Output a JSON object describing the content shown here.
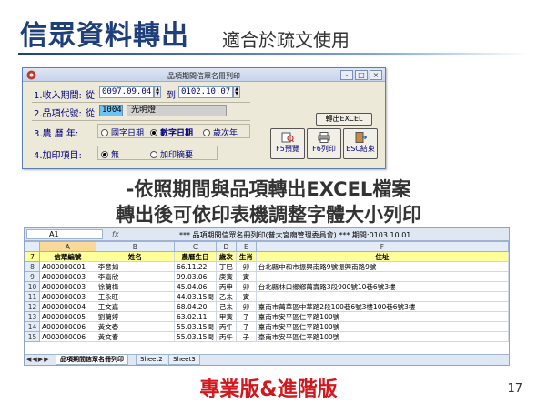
{
  "slide": {
    "title": "信眾資料轉出",
    "subtitle": "適合於疏文使用",
    "caption_line1": "-依照期間與品項轉出EXCEL檔案",
    "caption_line2": "轉出後可依印表機調整字體大小列印",
    "edition": "專業版&進階版",
    "page_number": "17"
  },
  "dialog": {
    "title": "品項期間信眾名冊列印",
    "window_buttons": [
      "-",
      "□",
      "×"
    ],
    "row1_label": "1.收入期間:",
    "from_label": "從",
    "date_from": "0097.09.04",
    "to_label": "到",
    "date_to": "0102.10.07",
    "row2_label": "2.品項代號:",
    "row2_from_label": "從",
    "item_code": "1004",
    "item_name": "光明燈",
    "export_button": "轉出EXCEL",
    "row3_label": "3.農  曆  年:",
    "calendar_options": [
      "國字日期",
      "數字日期",
      "歲次年"
    ],
    "calendar_selected": "數字日期",
    "row4_label": "4.加印項目:",
    "extra_options": [
      "無",
      "加印摘要"
    ],
    "extra_selected": "無",
    "btn_preview": "F5預覽",
    "btn_print": "F6列印",
    "btn_exit": "ESC結束"
  },
  "sheet": {
    "namebox": "A1",
    "fx": "fx",
    "formula": "*** 品項期間信眾名冊列印(普大宮廟管理委員會) *** 期間:0103.10.01",
    "col_letters": [
      "A",
      "B",
      "C",
      "D",
      "E",
      "F"
    ],
    "header_row_num": "7",
    "headers": [
      "信眾編號",
      "姓名",
      "農曆生日",
      "歲次",
      "生肖",
      "住址"
    ],
    "rows": [
      {
        "num": "8",
        "cells": [
          "A000000001",
          "李意如",
          "66.11.22",
          "丁巳",
          "卯",
          "台北縣中和市振興南路9號振興南路9號"
        ]
      },
      {
        "num": "9",
        "cells": [
          "A000000003",
          "李嘉欣",
          "99.03.06",
          "庚寅",
          "寅",
          ""
        ]
      },
      {
        "num": "10",
        "cells": [
          "A000000003",
          "徐蘭梅",
          "45.04.06",
          "丙申",
          "卯",
          "台北縣林口鄉鄉萬壽路3段900號10巷6號3樓"
        ]
      },
      {
        "num": "11",
        "cells": [
          "A000000003",
          "王永旺",
          "44.03.15閏",
          "乙未",
          "寅",
          ""
        ]
      },
      {
        "num": "12",
        "cells": [
          "A000000004",
          "王文嘉",
          "68.04.20",
          "己未",
          "卯",
          "臺南市萬華區中華路2段100巷6號3樓100巷6號3樓"
        ]
      },
      {
        "num": "13",
        "cells": [
          "A000000005",
          "劉蘭婷",
          "63.02.11",
          "甲寅",
          "子",
          "臺南市安平區仁平路100號"
        ]
      },
      {
        "num": "14",
        "cells": [
          "A000000006",
          "黃文春",
          "55.03.15閏",
          "丙午",
          "子",
          "臺南市安平區仁平路100號"
        ]
      },
      {
        "num": "15",
        "cells": [
          "A000000006",
          "黃文春",
          "55.03.15閏",
          "丙午",
          "子",
          "臺南市安平區仁平路100號"
        ]
      }
    ],
    "tab_nav": "◀◀▶▶",
    "tabs": [
      "品項期間信眾名冊列印",
      "Sheet2",
      "Sheet3"
    ]
  }
}
